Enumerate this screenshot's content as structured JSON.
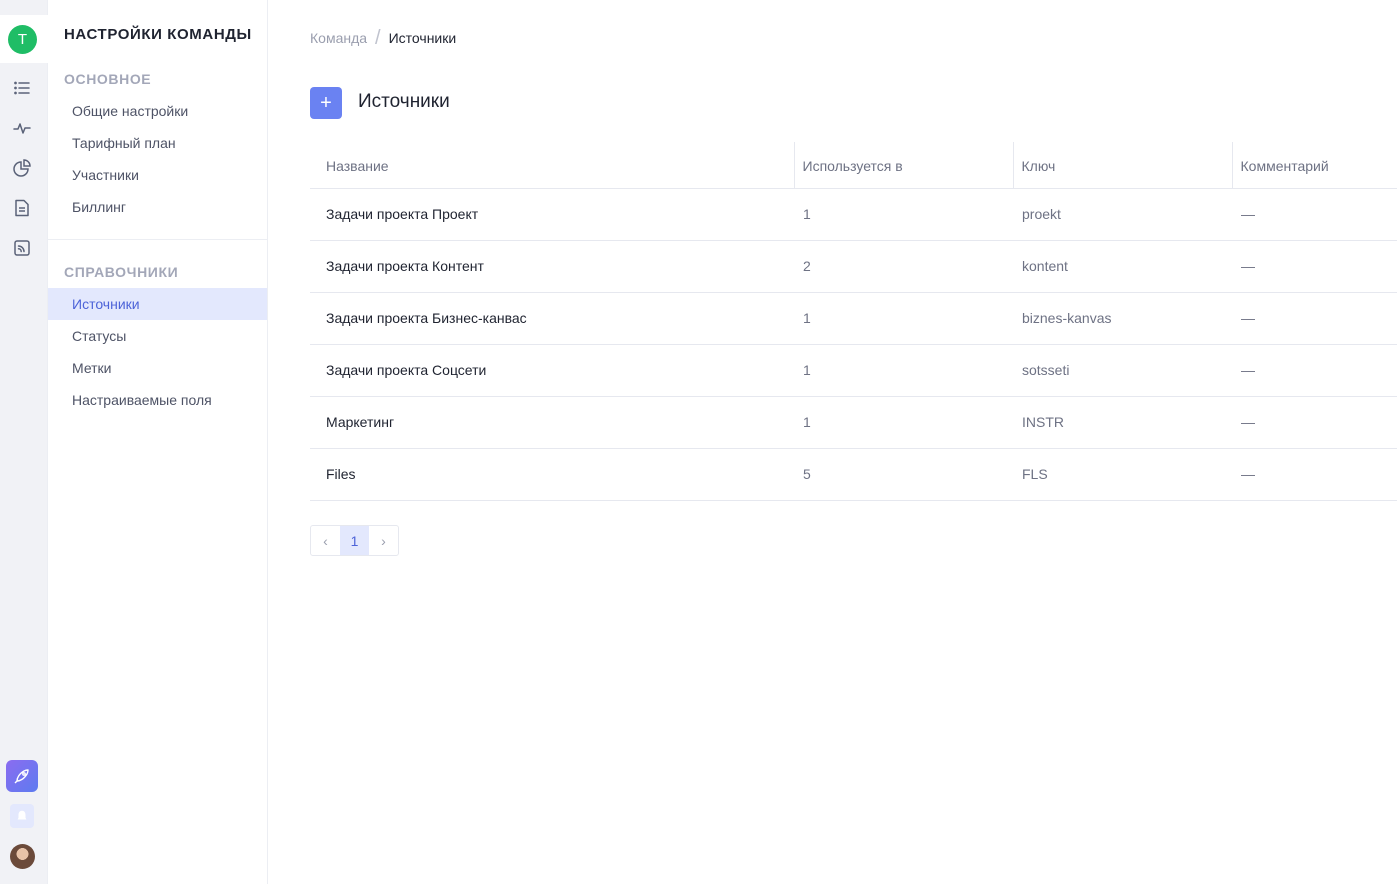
{
  "rail": {
    "team_initial": "T",
    "icons": [
      "list-icon",
      "activity-icon",
      "pie-chart-icon",
      "document-icon",
      "rss-icon"
    ],
    "bottom": [
      "rocket-icon",
      "bell-icon",
      "user-avatar"
    ]
  },
  "sidebar": {
    "title": "НАСТРОЙКИ КОМАНДЫ",
    "sections": [
      {
        "label": "ОСНОВНОЕ",
        "items": [
          "Общие настройки",
          "Тарифный план",
          "Участники",
          "Биллинг"
        ]
      },
      {
        "label": "СПРАВОЧНИКИ",
        "items": [
          "Источники",
          "Статусы",
          "Метки",
          "Настраиваемые поля"
        ]
      }
    ],
    "active_item": "Источники"
  },
  "breadcrumb": {
    "parent": "Команда",
    "separator": "/",
    "current": "Источники"
  },
  "page": {
    "add_label": "+",
    "title": "Источники"
  },
  "table": {
    "headers": [
      "Название",
      "Используется в",
      "Ключ",
      "Комментарий"
    ],
    "rows": [
      [
        "Задачи проекта Проект",
        "1",
        "proekt",
        "—"
      ],
      [
        "Задачи проекта Контент",
        "2",
        "kontent",
        "—"
      ],
      [
        "Задачи проекта Бизнес-канвас",
        "1",
        "biznes-kanvas",
        "—"
      ],
      [
        "Задачи проекта Соцсети",
        "1",
        "sotsseti",
        "—"
      ],
      [
        "Маркетинг",
        "1",
        "INSTR",
        "—"
      ],
      [
        "Files",
        "5",
        "FLS",
        "—"
      ]
    ]
  },
  "pagination": {
    "prev": "‹",
    "current": "1",
    "next": "›"
  },
  "colors": {
    "accent": "#6a82f2",
    "active_bg": "#e3e8fd",
    "team_avatar": "#1fbd66"
  }
}
